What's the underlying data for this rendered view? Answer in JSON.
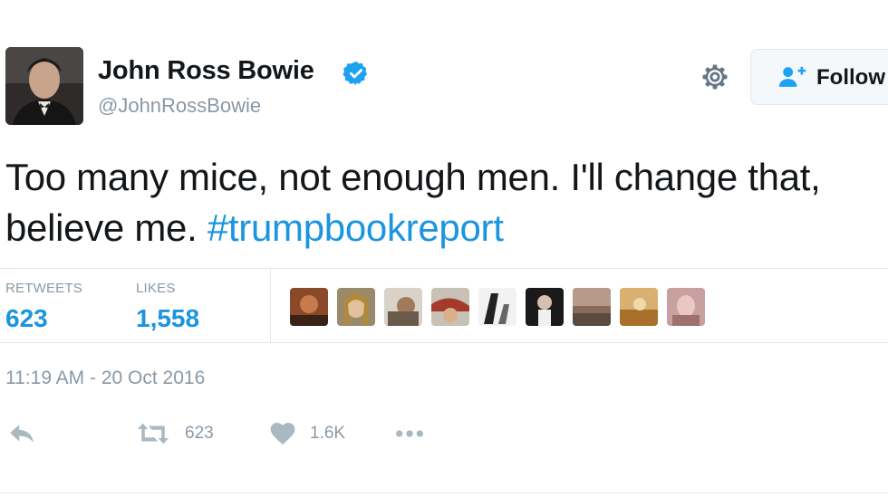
{
  "user": {
    "name": "John Ross Bowie",
    "handle": "@JohnRossBowie",
    "verified": true
  },
  "actions_top": {
    "follow_label": "Follow"
  },
  "tweet": {
    "text": "Too many mice, not enough men. I'll change that, believe me.",
    "hashtag": "#trumpbookreport",
    "timestamp": "11:19 AM - 20 Oct 2016"
  },
  "stats": {
    "retweets_label": "RETWEETS",
    "retweets_value": "623",
    "likes_label": "LIKES",
    "likes_value": "1,558"
  },
  "action_bar": {
    "retweet_count": "623",
    "like_count": "1.6K"
  },
  "colors": {
    "link": "#1b95e0",
    "secondary_text": "#8899a6",
    "border": "#e1e8ed"
  }
}
